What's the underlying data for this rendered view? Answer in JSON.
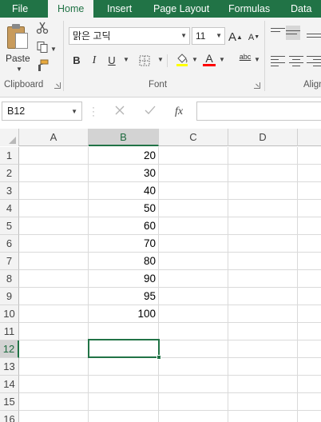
{
  "ribbon_tabs": [
    "File",
    "Home",
    "Insert",
    "Page Layout",
    "Formulas",
    "Data"
  ],
  "active_tab": "Home",
  "accent_color": "#217346",
  "clipboard": {
    "paste_label": "Paste",
    "group_label": "Clipboard",
    "icons": [
      "paste-icon",
      "cut-icon",
      "copy-icon",
      "format-painter-icon"
    ]
  },
  "font_group": {
    "font_name": "맑은 고딕",
    "font_size": "11",
    "bold": "B",
    "italic": "I",
    "underline": "U",
    "font_color_glyph": "A",
    "grow_glyph": "A",
    "shrink_glyph": "A",
    "group_label": "Font",
    "highlight_color": "#ffff00",
    "font_color": "#ff0000"
  },
  "alignment_group": {
    "group_label": "Align",
    "orientation_glyph": "abc"
  },
  "formula_bar": {
    "name_box": "B12",
    "fx": "fx",
    "formula_value": ""
  },
  "columns": [
    "A",
    "B",
    "C",
    "D"
  ],
  "selected_column": "B",
  "rows": [
    {
      "num": "1",
      "b": "20"
    },
    {
      "num": "2",
      "b": "30"
    },
    {
      "num": "3",
      "b": "40"
    },
    {
      "num": "4",
      "b": "50"
    },
    {
      "num": "5",
      "b": "60"
    },
    {
      "num": "6",
      "b": "70"
    },
    {
      "num": "7",
      "b": "80"
    },
    {
      "num": "8",
      "b": "90"
    },
    {
      "num": "9",
      "b": "95"
    },
    {
      "num": "10",
      "b": "100"
    },
    {
      "num": "11",
      "b": ""
    },
    {
      "num": "12",
      "b": ""
    },
    {
      "num": "13",
      "b": ""
    },
    {
      "num": "14",
      "b": ""
    },
    {
      "num": "15",
      "b": ""
    },
    {
      "num": "16",
      "b": ""
    }
  ],
  "active_cell": "B12"
}
